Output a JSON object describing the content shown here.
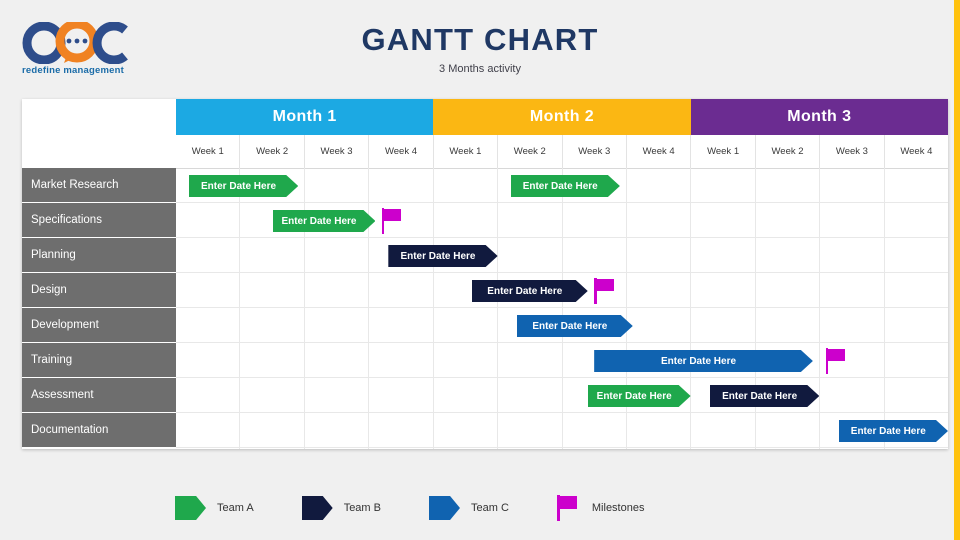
{
  "brand": {
    "caption": "redefine management",
    "logo_icon": "ooc-speech-bubble-logo",
    "colors": {
      "navy": "#2E4D8B",
      "orange": "#F08222",
      "caption": "#1B6CA8"
    }
  },
  "header": {
    "title": "GANTT CHART",
    "subtitle": "3 Months activity",
    "title_color": "#1F3864"
  },
  "accent_bar_color": "#FFC20E",
  "chart_data": {
    "type": "bar",
    "title": "GANTT CHART",
    "subtitle": "3 Months activity",
    "xlabel": "",
    "ylabel": "",
    "grid": true,
    "legend_position": "bottom",
    "months": [
      {
        "label": "Month 1",
        "color": "#1CA9E3",
        "weeks": [
          "Week 1",
          "Week 2",
          "Week 3",
          "Week 4"
        ]
      },
      {
        "label": "Month 2",
        "color": "#FBB713",
        "weeks": [
          "Week 1",
          "Week 2",
          "Week 3",
          "Week 4"
        ]
      },
      {
        "label": "Month 3",
        "color": "#6B2C91",
        "weeks": [
          "Week 1",
          "Week 2",
          "Week 3",
          "Week 4"
        ]
      }
    ],
    "week_columns": [
      "Week 1",
      "Week 2",
      "Week 3",
      "Week 4",
      "Week 1",
      "Week 2",
      "Week 3",
      "Week 4",
      "Week 1",
      "Week 2",
      "Week 3",
      "Week 4"
    ],
    "teams": [
      {
        "name": "Team A",
        "color": "#1FA84C"
      },
      {
        "name": "Team B",
        "color": "#111A3E"
      },
      {
        "name": "Team C",
        "color": "#1063B0"
      },
      {
        "name": "Milestones",
        "color": "#CC00CC"
      }
    ],
    "bar_label": "Enter Date Here",
    "categories": [
      "Market Research",
      "Specifications",
      "Planning",
      "Design",
      "Development",
      "Training",
      "Assessment",
      "Documentation"
    ],
    "tasks": [
      {
        "name": "Market Research",
        "bars": [
          {
            "team": "Team A",
            "color": "#1FA84C",
            "start_week": 1.2,
            "end_week": 2.9,
            "label": "Enter Date Here"
          },
          {
            "team": "Team A",
            "color": "#1FA84C",
            "start_week": 6.2,
            "end_week": 7.9,
            "label": "Enter Date Here"
          }
        ],
        "milestones": []
      },
      {
        "name": "Specifications",
        "bars": [
          {
            "team": "Team A",
            "color": "#1FA84C",
            "start_week": 2.5,
            "end_week": 4.1,
            "label": "Enter Date Here"
          }
        ],
        "milestones": [
          {
            "week": 4.2
          }
        ]
      },
      {
        "name": "Planning",
        "bars": [
          {
            "team": "Team B",
            "color": "#111A3E",
            "start_week": 4.3,
            "end_week": 6.0,
            "label": "Enter Date Here"
          }
        ],
        "milestones": []
      },
      {
        "name": "Design",
        "bars": [
          {
            "team": "Team B",
            "color": "#111A3E",
            "start_week": 5.6,
            "end_week": 7.4,
            "label": "Enter Date Here"
          }
        ],
        "milestones": [
          {
            "week": 7.5
          }
        ]
      },
      {
        "name": "Development",
        "bars": [
          {
            "team": "Team C",
            "color": "#1063B0",
            "start_week": 6.3,
            "end_week": 8.1,
            "label": "Enter Date Here"
          }
        ],
        "milestones": []
      },
      {
        "name": "Training",
        "bars": [
          {
            "team": "Team C",
            "color": "#1063B0",
            "start_week": 7.5,
            "end_week": 10.9,
            "label": "Enter Date Here"
          }
        ],
        "milestones": [
          {
            "week": 11.1
          }
        ]
      },
      {
        "name": "Assessment",
        "bars": [
          {
            "team": "Team A",
            "color": "#1FA84C",
            "start_week": 7.4,
            "end_week": 9.0,
            "label": "Enter Date Here"
          },
          {
            "team": "Team B",
            "color": "#111A3E",
            "start_week": 9.3,
            "end_week": 11.0,
            "label": "Enter Date Here"
          }
        ],
        "milestones": []
      },
      {
        "name": "Documentation",
        "bars": [
          {
            "team": "Team C",
            "color": "#1063B0",
            "start_week": 11.3,
            "end_week": 13.0,
            "label": "Enter Date Here"
          }
        ],
        "milestones": []
      }
    ]
  },
  "legend": {
    "items": [
      {
        "label": "Team A",
        "icon": "arrow-swatch",
        "color": "#1FA84C"
      },
      {
        "label": "Team B",
        "icon": "arrow-swatch",
        "color": "#111A3E"
      },
      {
        "label": "Team C",
        "icon": "arrow-swatch",
        "color": "#1063B0"
      },
      {
        "label": "Milestones",
        "icon": "flag-icon",
        "color": "#CC00CC"
      }
    ]
  }
}
